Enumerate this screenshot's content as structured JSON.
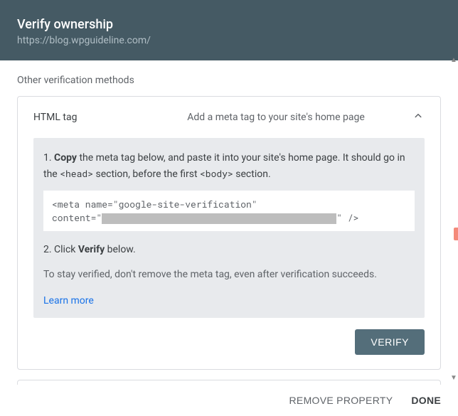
{
  "header": {
    "title": "Verify ownership",
    "url": "https://blog.wpguideline.com/"
  },
  "section_label": "Other verification methods",
  "method": {
    "name": "HTML tag",
    "description": "Add a meta tag to your site's home page"
  },
  "panel": {
    "step1_prefix": "1. ",
    "step1_bold": "Copy",
    "step1_mid": " the meta tag below, and paste it into your site's home page. It should go in the ",
    "step1_code1": "<head>",
    "step1_mid2": " section, before the first ",
    "step1_code2": "<body>",
    "step1_end": " section.",
    "code_line1": "<meta name=\"google-site-verification\"",
    "code_line2_prefix": "content=\"",
    "code_line2_suffix": "\" />",
    "step2_prefix": "2. Click ",
    "step2_bold": "Verify",
    "step2_end": " below.",
    "note": "To stay verified, don't remove the meta tag, even after verification succeeds.",
    "learn_more": "Learn more"
  },
  "verify_label": "VERIFY",
  "footer": {
    "remove": "REMOVE PROPERTY",
    "done": "DONE"
  }
}
